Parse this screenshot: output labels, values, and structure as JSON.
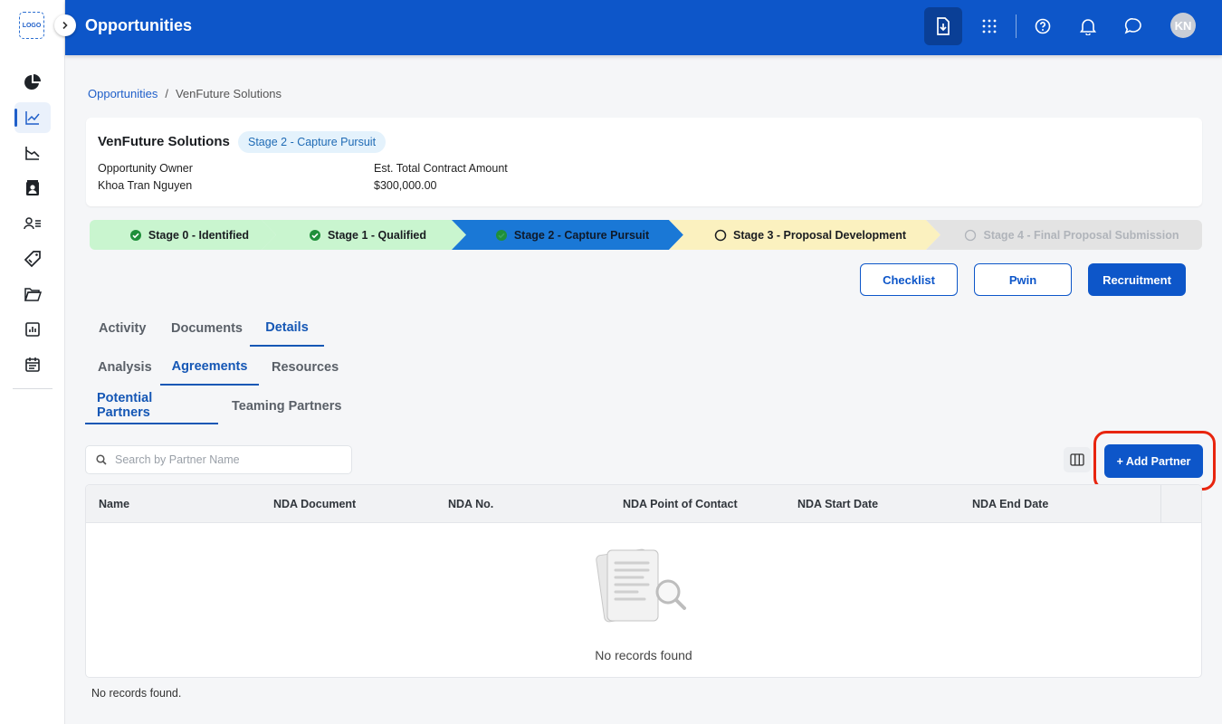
{
  "app": {
    "title": "Opportunities",
    "logo_text": "LOGO",
    "avatar_initials": "KN"
  },
  "sidebar": {
    "items": [
      {
        "icon": "pie-chart-icon"
      },
      {
        "icon": "line-chart-icon",
        "active": true
      },
      {
        "icon": "area-chart-icon"
      },
      {
        "icon": "contact-book-icon"
      },
      {
        "icon": "user-list-icon"
      },
      {
        "icon": "tag-icon"
      },
      {
        "icon": "folder-icon"
      },
      {
        "icon": "bar-report-icon"
      },
      {
        "icon": "calendar-icon"
      }
    ]
  },
  "topbar": {
    "icons": [
      "download-icon",
      "apps-grid-icon",
      "help-icon",
      "bell-icon",
      "chat-icon"
    ]
  },
  "breadcrumb": {
    "parent": "Opportunities",
    "separator": "/",
    "current": "VenFuture Solutions"
  },
  "opportunity": {
    "name": "VenFuture Solutions",
    "stage_badge": "Stage 2 - Capture Pursuit",
    "owner_label": "Opportunity Owner",
    "owner_value": "Khoa Tran Nguyen",
    "amount_label": "Est. Total Contract Amount",
    "amount_value": "$300,000.00"
  },
  "stages": [
    {
      "label": "Stage 0 - Identified",
      "status": "complete"
    },
    {
      "label": "Stage 1 - Qualified",
      "status": "complete"
    },
    {
      "label": "Stage 2 - Capture Pursuit",
      "status": "current"
    },
    {
      "label": "Stage 3 - Proposal Development",
      "status": "next"
    },
    {
      "label": "Stage 4 - Final Proposal Submission",
      "status": "disabled"
    }
  ],
  "actions": {
    "checklist": "Checklist",
    "pwin": "Pwin",
    "recruitment": "Recruitment"
  },
  "tabs_level1": [
    "Activity",
    "Documents",
    "Details"
  ],
  "tabs_level2": [
    "Analysis",
    "Agreements",
    "Resources"
  ],
  "tabs_level3": [
    "Potential Partners",
    "Teaming Partners"
  ],
  "search": {
    "placeholder": "Search by Partner Name"
  },
  "add_partner": "+ Add Partner",
  "table": {
    "columns": [
      "Name",
      "NDA Document",
      "NDA No.",
      "NDA Point of Contact",
      "NDA Start Date",
      "NDA End Date"
    ],
    "empty_text": "No records found"
  },
  "footer_note": "No records found.",
  "colors": {
    "brand": "#0d56c9",
    "complete": "#c9f5cf",
    "current": "#1a78d6",
    "next": "#fbf1bf",
    "disabled": "#e3e3e3",
    "highlight": "#e8250f"
  }
}
